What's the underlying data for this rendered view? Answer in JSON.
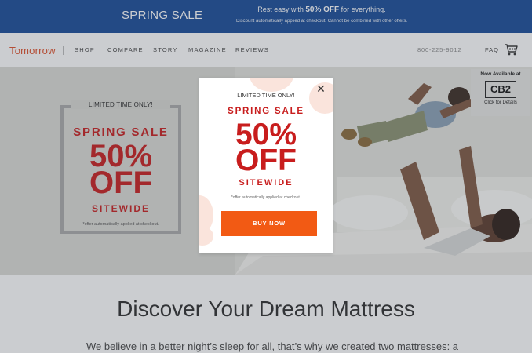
{
  "promo": {
    "left": "SPRING SALE",
    "line1_pre": "Rest easy with",
    "line1_bold": "50% OFF",
    "line1_post": "for everything.",
    "line2": "Discount automatically applied at checkout. Cannot be combined with other offers."
  },
  "nav": {
    "logo": "Tomorrow",
    "items": [
      "SHOP",
      "COMPARE",
      "STORY",
      "MAGAZINE",
      "REVIEWS"
    ],
    "phone": "800-225-9012",
    "faq": "FAQ",
    "cart_icon": "cart-icon"
  },
  "hero_box": {
    "tag": "LIMITED TIME ONLY!",
    "title": "SPRING SALE",
    "pct": "50%",
    "off": "OFF",
    "sitewide": "SITEWIDE",
    "note": "*offer automatically applied at checkout."
  },
  "cb2": {
    "top": "Now Available at",
    "logo": "CB2",
    "bottom": "Click for Details"
  },
  "main": {
    "heading": "Discover Your Dream Mattress",
    "blurb": "We believe in a better night’s sleep for all, that’s why we created two mattresses: a"
  },
  "modal": {
    "close_icon": "close-icon",
    "tag": "LIMITED TIME ONLY!",
    "title": "SPRING SALE",
    "pct": "50%",
    "off": "OFF",
    "sitewide": "SITEWIDE",
    "note": "*offer automatically applied at checkout.",
    "cta": "BUY NOW"
  },
  "colors": {
    "promo_bg": "#174a98",
    "brand_orange": "#e0502a",
    "sale_red": "#c81d1d",
    "cta_orange": "#f25a14"
  }
}
